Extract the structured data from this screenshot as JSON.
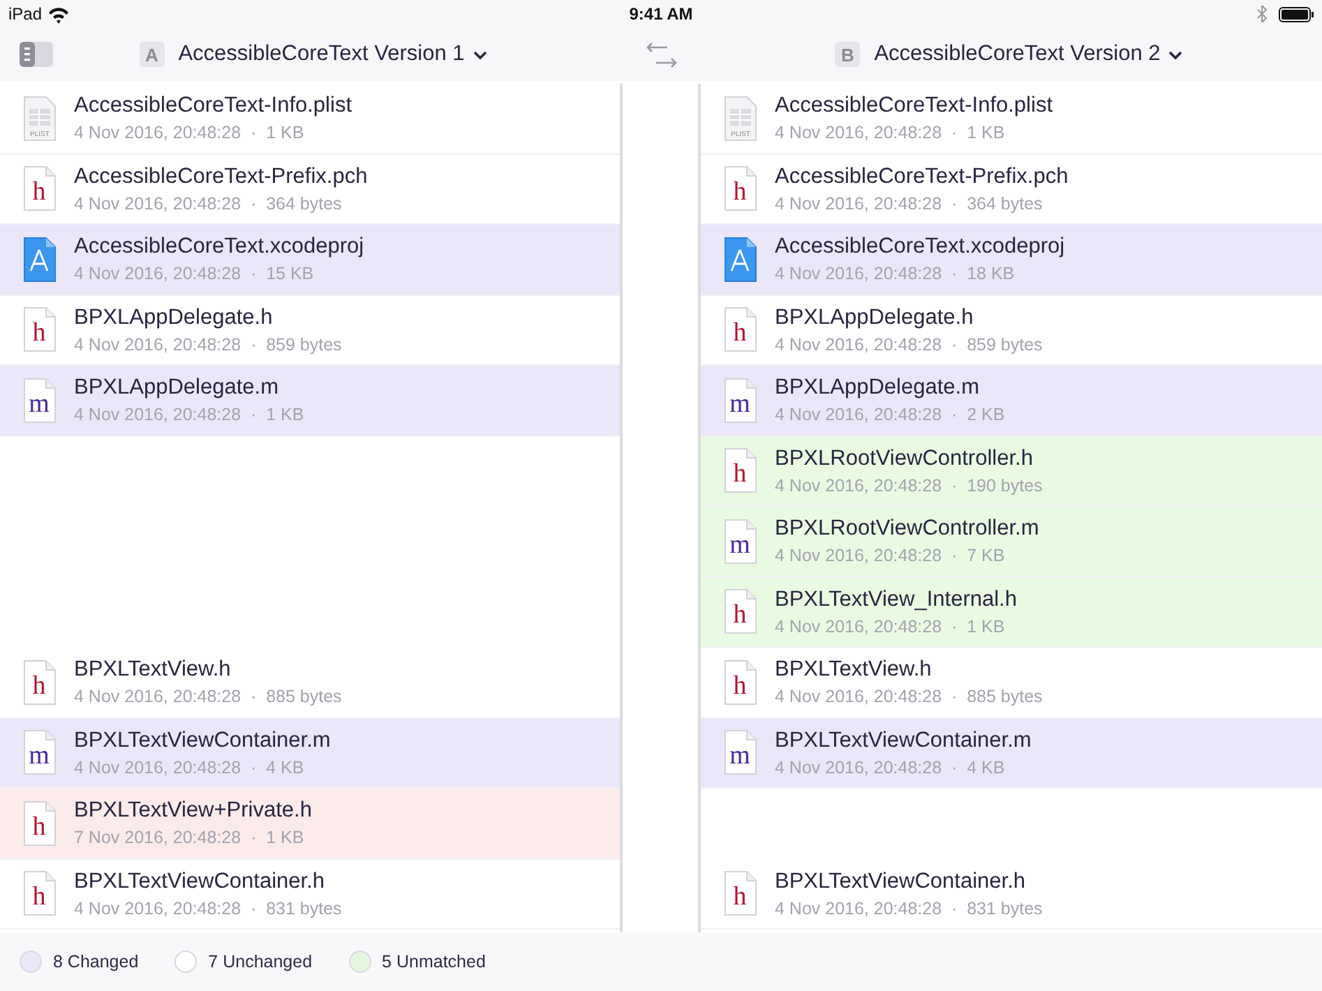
{
  "status_bar": {
    "device": "iPad",
    "time": "9:41 AM"
  },
  "toolbar": {
    "panes": [
      {
        "badge": "A",
        "title": "AccessibleCoreText Version 1"
      },
      {
        "badge": "B",
        "title": "AccessibleCoreText Version 2"
      }
    ]
  },
  "columns": [
    {
      "rows": [
        {
          "kind": "plist",
          "icon_label": "PLIST",
          "name": "AccessibleCoreText-Info.plist",
          "meta": "4 Nov 2016, 20:48:28  ·  1 KB",
          "color": "#ffffff"
        },
        {
          "kind": "header",
          "icon_label": "h",
          "name": "AccessibleCoreText-Prefix.pch",
          "meta": "4 Nov 2016, 20:48:28  ·  364 bytes",
          "color": "#ffffff"
        },
        {
          "kind": "project",
          "name": "AccessibleCoreText.xcodeproj",
          "meta": "4 Nov 2016, 20:48:28  ·  15 KB",
          "color": "#ebe6f8"
        },
        {
          "kind": "header",
          "icon_label": "h",
          "name": "BPXLAppDelegate.h",
          "meta": "4 Nov 2016, 20:48:28  ·  859 bytes",
          "color": "#ffffff"
        },
        {
          "kind": "implementation",
          "icon_label": "m",
          "name": "BPXLAppDelegate.m",
          "meta": "4 Nov 2016, 20:48:28  ·  1 KB",
          "color": "#ebe6f8"
        },
        {
          "kind": "gap"
        },
        {
          "kind": "gap"
        },
        {
          "kind": "gap"
        },
        {
          "kind": "header",
          "icon_label": "h",
          "name": "BPXLTextView.h",
          "meta": "4 Nov 2016, 20:48:28  ·  885 bytes",
          "color": "#ffffff"
        },
        {
          "kind": "implementation",
          "icon_label": "m",
          "name": "BPXLTextViewContainer.m",
          "meta": "4 Nov 2016, 20:48:28  ·  4 KB",
          "color": "#ebe6f8"
        },
        {
          "kind": "header",
          "icon_label": "h",
          "name": "BPXLTextView+Private.h",
          "meta": "7 Nov 2016, 20:48:28  ·  1 KB",
          "color": "#fbebea"
        },
        {
          "kind": "header",
          "icon_label": "h",
          "name": "BPXLTextViewContainer.h",
          "meta": "4 Nov 2016, 20:48:28  ·  831 bytes",
          "color": "#ffffff"
        }
      ]
    },
    {
      "rows": [
        {
          "kind": "plist",
          "icon_label": "PLIST",
          "name": "AccessibleCoreText-Info.plist",
          "meta": "4 Nov 2016, 20:48:28  ·  1 KB",
          "color": "#ffffff"
        },
        {
          "kind": "header",
          "icon_label": "h",
          "name": "AccessibleCoreText-Prefix.pch",
          "meta": "4 Nov 2016, 20:48:28  ·  364 bytes",
          "color": "#ffffff"
        },
        {
          "kind": "project",
          "name": "AccessibleCoreText.xcodeproj",
          "meta": "4 Nov 2016, 20:48:28  ·  18 KB",
          "color": "#ebe6f8"
        },
        {
          "kind": "header",
          "icon_label": "h",
          "name": "BPXLAppDelegate.h",
          "meta": "4 Nov 2016, 20:48:28  ·  859 bytes",
          "color": "#ffffff"
        },
        {
          "kind": "implementation",
          "icon_label": "m",
          "name": "BPXLAppDelegate.m",
          "meta": "4 Nov 2016, 20:48:28  ·  2 KB",
          "color": "#ebe6f8"
        },
        {
          "kind": "header",
          "icon_label": "h",
          "name": "BPXLRootViewController.h",
          "meta": "4 Nov 2016, 20:48:28  ·  190 bytes",
          "color": "#e8fbe2"
        },
        {
          "kind": "implementation",
          "icon_label": "m",
          "name": "BPXLRootViewController.m",
          "meta": "4 Nov 2016, 20:48:28  ·  7 KB",
          "color": "#e8fbe2"
        },
        {
          "kind": "header",
          "icon_label": "h",
          "name": "BPXLTextView_Internal.h",
          "meta": "4 Nov 2016, 20:48:28  ·  1 KB",
          "color": "#e8fbe2"
        },
        {
          "kind": "header",
          "icon_label": "h",
          "name": "BPXLTextView.h",
          "meta": "4 Nov 2016, 20:48:28  ·  885 bytes",
          "color": "#ffffff"
        },
        {
          "kind": "implementation",
          "icon_label": "m",
          "name": "BPXLTextViewContainer.m",
          "meta": "4 Nov 2016, 20:48:28  ·  4 KB",
          "color": "#ebe6f8"
        },
        {
          "kind": "gap"
        },
        {
          "kind": "header",
          "icon_label": "h",
          "name": "BPXLTextViewContainer.h",
          "meta": "4 Nov 2016, 20:48:28  ·  831 bytes",
          "color": "#ffffff"
        }
      ]
    }
  ],
  "legend": [
    {
      "color": "#ebe6f8",
      "label": "8 Changed"
    },
    {
      "color": "#ffffff",
      "label": "7 Unchanged"
    },
    {
      "color": "#e6f7e0",
      "label": "5 Unmatched"
    }
  ]
}
